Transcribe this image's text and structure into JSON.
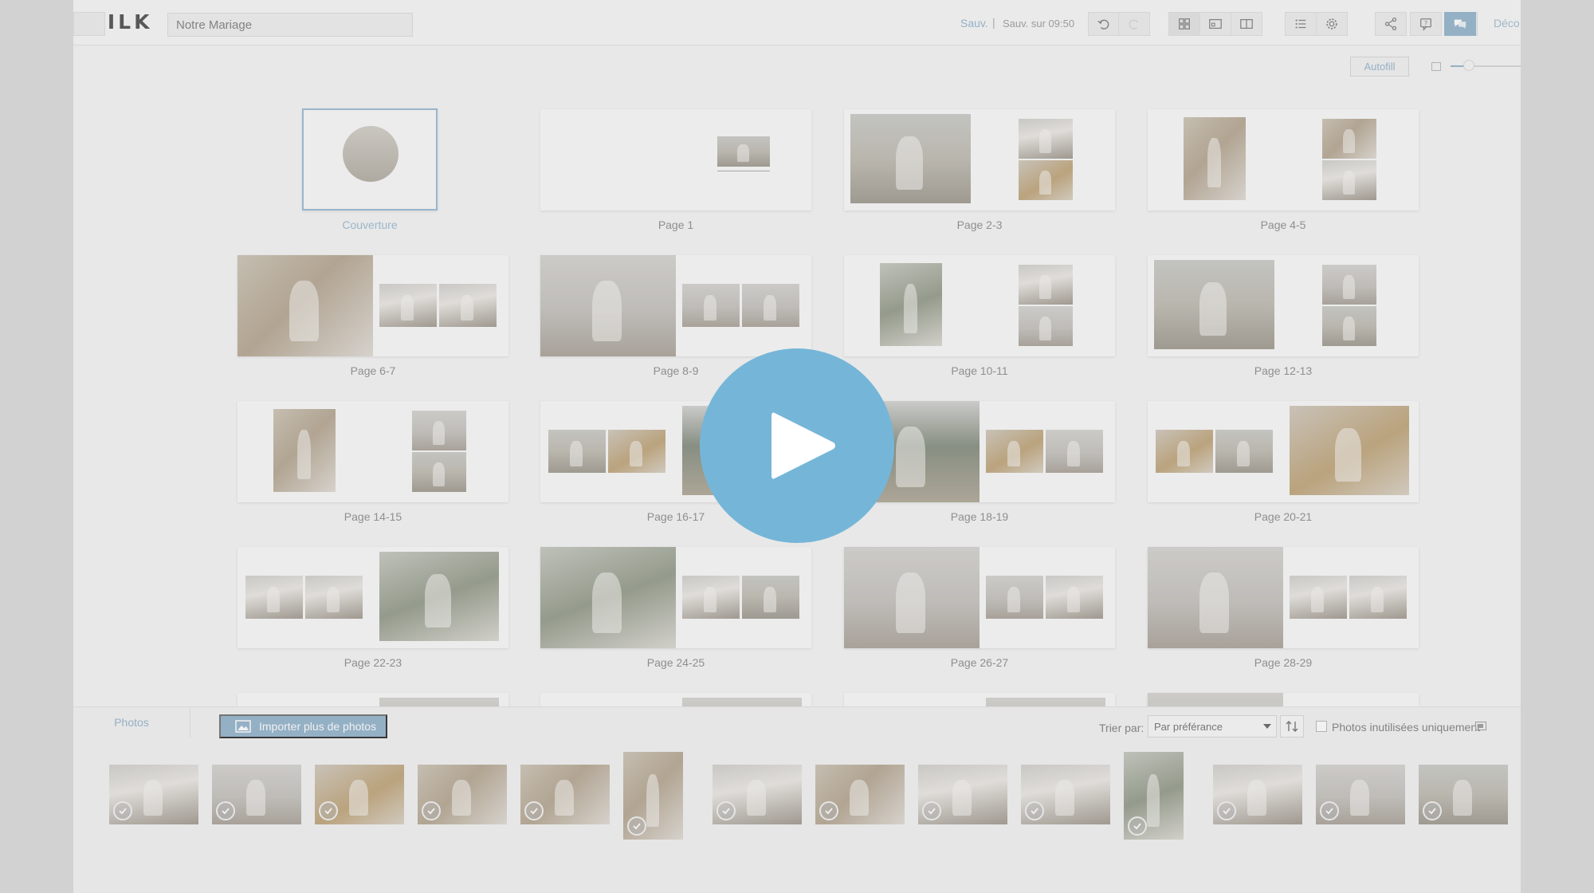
{
  "header": {
    "logo": "MILK",
    "project_title": "Notre Mariage",
    "save_link": "Sauv.",
    "save_separator": "|",
    "save_status": "Sauv. sur 09:50",
    "deco_link": "Déco"
  },
  "toolbar": {
    "undo_icon": "undo-icon",
    "redo_icon": "redo-icon",
    "view_icons": [
      "grid-view-icon",
      "page-view-icon",
      "spread-view-icon"
    ],
    "list_icon": "list-icon",
    "settings_icon": "gear-icon",
    "share_icon": "share-icon",
    "help_icon": "help-icon",
    "chat_icon": "chat-icon",
    "autofill_label": "Autofill",
    "zoom_level": 0.2
  },
  "spreads": [
    {
      "label": "Couverture",
      "type": "cover"
    },
    {
      "label": "Page 1"
    },
    {
      "label": "Page 2-3"
    },
    {
      "label": "Page 4-5"
    },
    {
      "label": "Page 6-7"
    },
    {
      "label": "Page 8-9"
    },
    {
      "label": "Page 10-11"
    },
    {
      "label": "Page 12-13"
    },
    {
      "label": "Page 14-15"
    },
    {
      "label": "Page 16-17"
    },
    {
      "label": "Page 18-19"
    },
    {
      "label": "Page 20-21"
    },
    {
      "label": "Page 22-23"
    },
    {
      "label": "Page 24-25"
    },
    {
      "label": "Page 26-27"
    },
    {
      "label": "Page 28-29"
    }
  ],
  "photo_panel": {
    "tab_label": "Photos",
    "import_button": "Importer plus de photos",
    "import_icon": "image-icon",
    "sort_label": "Trier par:",
    "sort_value": "Par préférance",
    "sort_order_icon": "sort-arrows-icon",
    "unused_only_label": "Photos inutilisées uniquement",
    "unused_only_checked": false,
    "panel_toggle_icon": "panel-toggle-icon"
  },
  "photos": [
    {
      "orientation": "landscape",
      "used": true
    },
    {
      "orientation": "landscape",
      "used": true
    },
    {
      "orientation": "landscape",
      "used": true
    },
    {
      "orientation": "landscape",
      "used": true
    },
    {
      "orientation": "landscape",
      "used": true
    },
    {
      "orientation": "portrait",
      "used": true
    },
    {
      "orientation": "landscape",
      "used": true
    },
    {
      "orientation": "landscape",
      "used": true
    },
    {
      "orientation": "landscape",
      "used": true
    },
    {
      "orientation": "landscape",
      "used": true
    },
    {
      "orientation": "portrait",
      "used": true
    },
    {
      "orientation": "landscape",
      "used": true
    },
    {
      "orientation": "landscape",
      "used": true
    },
    {
      "orientation": "landscape",
      "used": true
    }
  ],
  "overlay": {
    "play_icon": "play-icon",
    "play_color": "#75b6d8"
  },
  "colors": {
    "accent": "#7ea6c2",
    "background": "#f3f3f3"
  }
}
